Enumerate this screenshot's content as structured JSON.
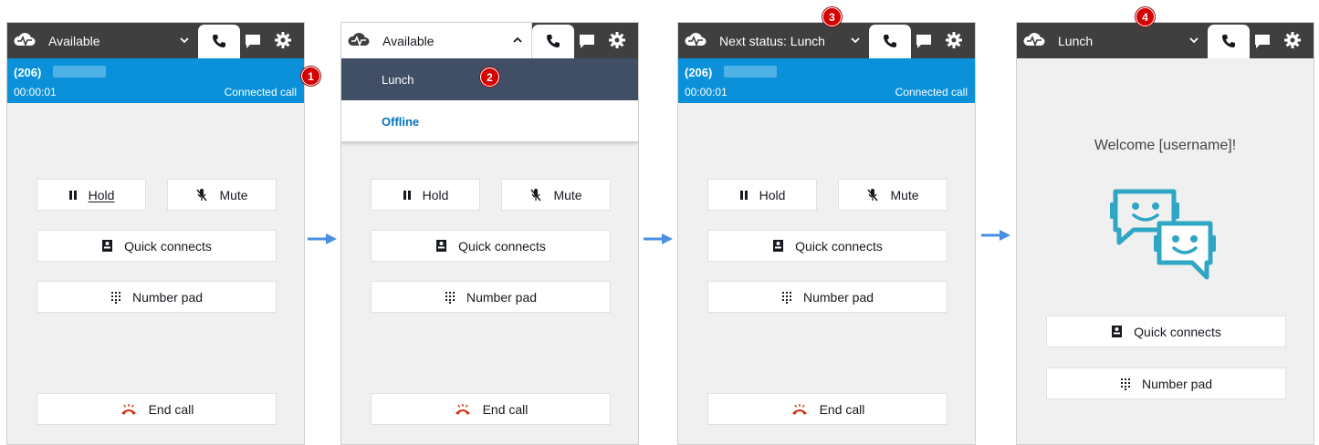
{
  "panels": {
    "p1": {
      "status": "Available",
      "call": {
        "number": "(206)",
        "timer": "00:00:01",
        "state": "Connected call"
      },
      "buttons": {
        "hold": "Hold",
        "mute": "Mute",
        "quick_connects": "Quick connects",
        "number_pad": "Number pad",
        "end_call": "End call"
      },
      "badge": "1"
    },
    "p2": {
      "status": "Available",
      "menu": [
        "Lunch",
        "Offline"
      ],
      "buttons": {
        "hold": "Hold",
        "mute": "Mute",
        "quick_connects": "Quick connects",
        "number_pad": "Number pad",
        "end_call": "End call"
      },
      "badge": "2"
    },
    "p3": {
      "status": "Next status: Lunch",
      "call": {
        "number": "(206)",
        "timer": "00:00:01",
        "state": "Connected call"
      },
      "buttons": {
        "hold": "Hold",
        "mute": "Mute",
        "quick_connects": "Quick connects",
        "number_pad": "Number pad",
        "end_call": "End call"
      },
      "badge": "3"
    },
    "p4": {
      "status": "Lunch",
      "welcome": "Welcome [username]!",
      "buttons": {
        "quick_connects": "Quick connects",
        "number_pad": "Number pad"
      },
      "badge": "4"
    }
  },
  "icons": {
    "brand": "cloud-pulse-icon",
    "phone_tab": "phone-icon",
    "chat_tab": "chat-bubble-icon",
    "settings_tab": "gear-icon",
    "hold": "pause-icon",
    "mute": "mic-off-icon",
    "quick_connects": "contact-card-icon",
    "number_pad": "keypad-icon",
    "end_call": "hang-up-icon",
    "flow": "arrow-right-icon"
  },
  "colors": {
    "topbar": "#3f3f3f",
    "call_banner": "#0a91d9",
    "menu_selected": "#404f66",
    "menu_link": "#0073bb",
    "end_call": "#d13212",
    "badge": "#d50000",
    "flow_arrow": "#4a90e2",
    "bot": "#2fa7c4"
  }
}
